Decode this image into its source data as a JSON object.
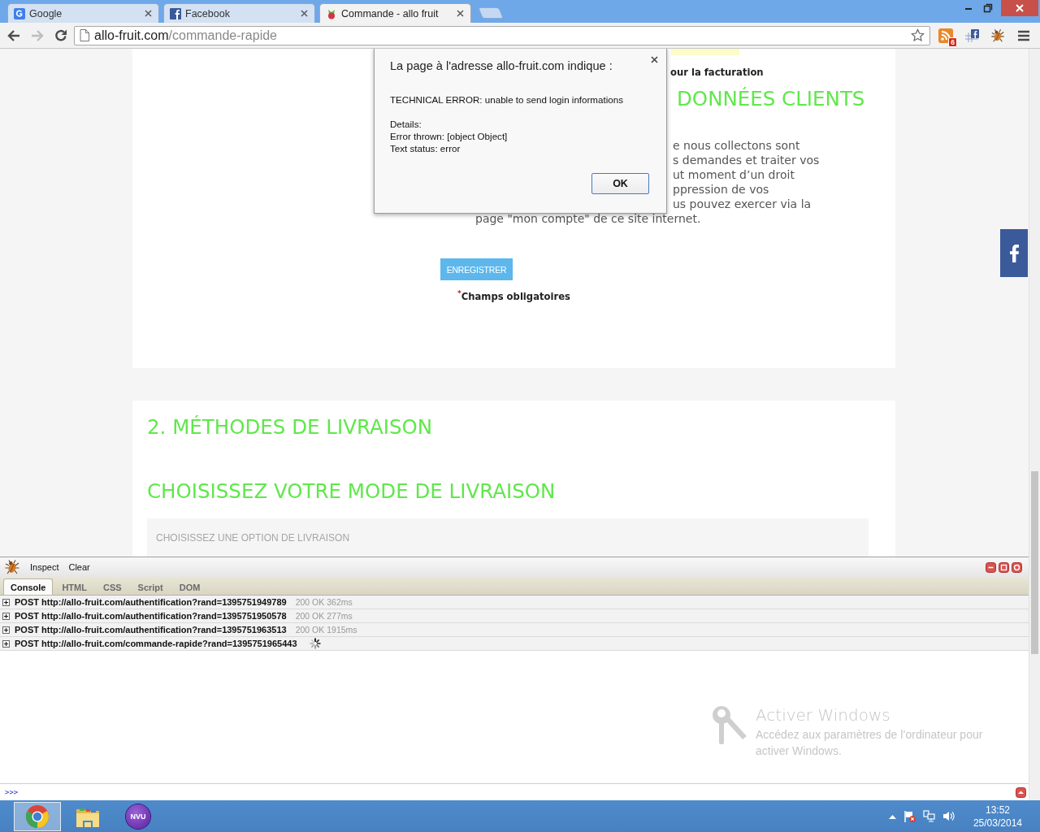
{
  "browser": {
    "tabs": [
      {
        "kind": "search",
        "title": "Google",
        "selected": false
      },
      {
        "kind": "social",
        "title": "Facebook",
        "selected": false
      },
      {
        "kind": "shop",
        "title": "Commande - allo fruit",
        "selected": true
      }
    ],
    "navigation": [
      {
        "kind": "back",
        "disabled": false
      },
      {
        "kind": "forward",
        "disabled": true
      },
      {
        "kind": "reload",
        "disabled": false
      }
    ],
    "address": {
      "host": "allo-fruit.com",
      "path": "/commande-rapide"
    },
    "extensions": [
      {
        "kind": "feed",
        "badge": "6"
      },
      {
        "kind": "social"
      },
      {
        "kind": "bug"
      }
    ]
  },
  "page": {
    "billing_label": "our la facturation",
    "section_heading": "DONNÉES CLIENTS",
    "privacy_fragments": [
      "e nous collectons sont",
      "s demandes et traiter vos",
      "ut moment d’un droit",
      "ppression de vos",
      "us pouvez exercer via la"
    ],
    "privacy_last_line": "page \"mon compte\" de ce site internet.",
    "save_button": "ENREGISTRER",
    "required_note": {
      "mark": "*",
      "text": "Champs obligatoires"
    },
    "delivery": {
      "heading": "2. MÉTHODES DE LIVRAISON",
      "subheading": "CHOISISSEZ VOTRE MODE DE LIVRAISON",
      "placeholder": "CHOISISSEZ UNE OPTION DE LIVRAISON"
    }
  },
  "alert": {
    "title": "La page à l'adresse allo-fruit.com indique :",
    "message": "TECHNICAL ERROR: unable to send login informations",
    "details": "Details:\nError thrown: [object Object]\nText status: error",
    "button": "OK"
  },
  "devtools": {
    "actions": [
      "Inspect",
      "Clear"
    ],
    "tabs": [
      {
        "label": "Console",
        "selected": true
      },
      {
        "label": "HTML",
        "selected": false
      },
      {
        "label": "CSS",
        "selected": false
      },
      {
        "label": "Script",
        "selected": false
      },
      {
        "label": "DOM",
        "selected": false
      }
    ],
    "log": [
      {
        "request": "POST http://allo-fruit.com/authentification?rand=1395751949789",
        "status": "200 OK 362ms",
        "pending": false
      },
      {
        "request": "POST http://allo-fruit.com/authentification?rand=1395751950578",
        "status": "200 OK 277ms",
        "pending": false
      },
      {
        "request": "POST http://allo-fruit.com/authentification?rand=1395751963513",
        "status": "200 OK 1915ms",
        "pending": false
      },
      {
        "request": "POST http://allo-fruit.com/commande-rapide?rand=1395751965443",
        "pending": true
      }
    ],
    "prompt": ">>>"
  },
  "activation_notice": {
    "title": "Activer Windows",
    "text": "Accédez aux paramètres de l’ordinateur pour activer Windows."
  },
  "taskbar": {
    "apps": [
      {
        "kind": "browser",
        "selected": true
      },
      {
        "kind": "folder",
        "selected": false
      },
      {
        "kind": "editor",
        "logo_text": "NVU",
        "selected": false
      }
    ],
    "time": "13:52",
    "date": "25/03/2014"
  }
}
